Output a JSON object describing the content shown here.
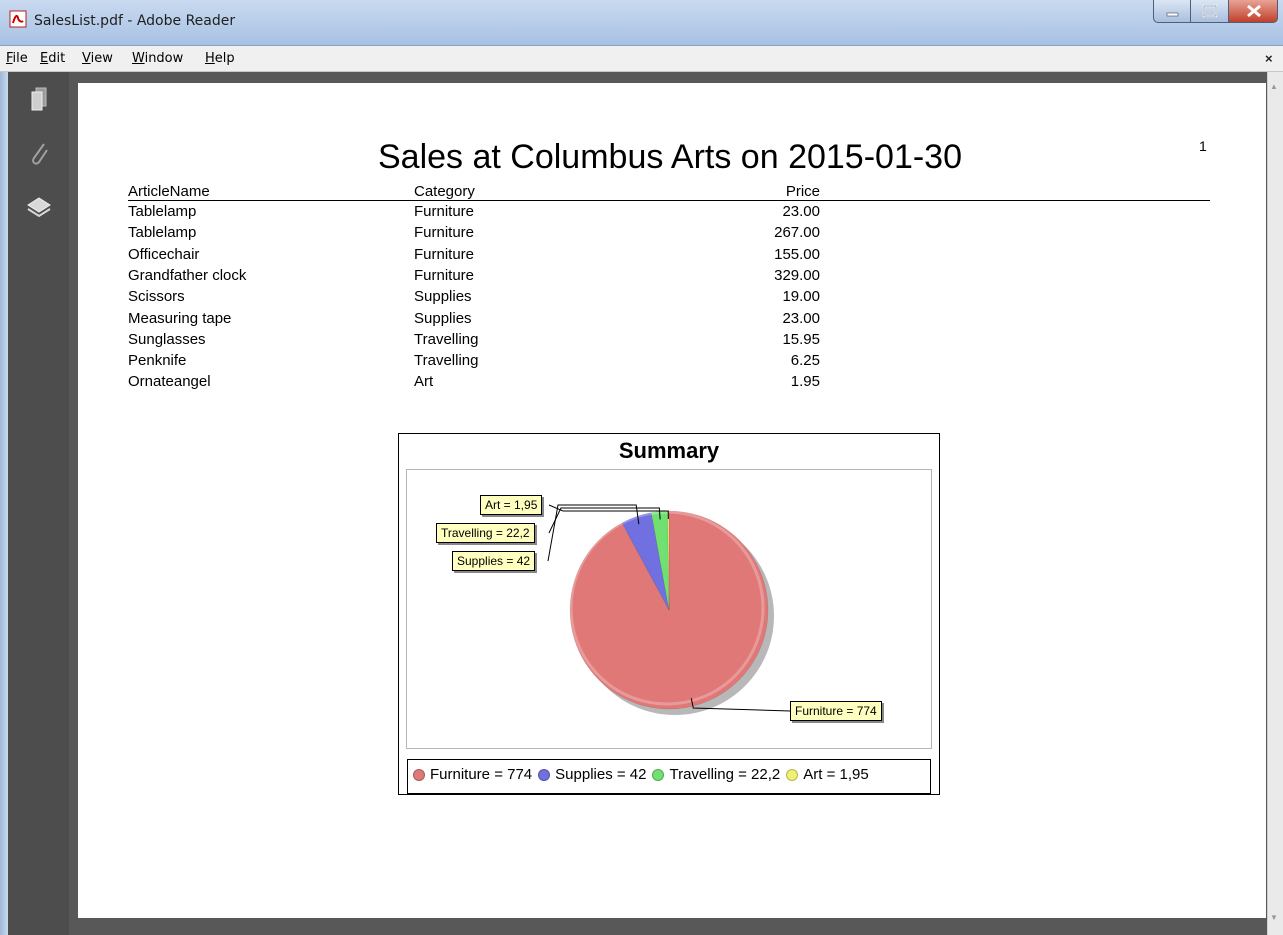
{
  "window": {
    "title": "SalesList.pdf - Adobe Reader"
  },
  "menu": {
    "items": [
      {
        "label": "File",
        "accel": "F",
        "rest": "ile"
      },
      {
        "label": "Edit",
        "accel": "E",
        "rest": "dit"
      },
      {
        "label": "View",
        "accel": "V",
        "rest": "iew"
      },
      {
        "label": "Window",
        "accel": "W",
        "rest": "indow"
      },
      {
        "label": "Help",
        "accel": "H",
        "rest": "elp"
      }
    ],
    "close_glyph": "×"
  },
  "sidebar": {
    "tools": [
      "pages-icon",
      "attachment-icon",
      "layers-icon"
    ]
  },
  "report": {
    "title": "Sales at Columbus Arts on 2015-01-30",
    "page_number": "1",
    "headers": {
      "article": "ArticleName",
      "category": "Category",
      "price": "Price"
    },
    "rows": [
      {
        "article": "Tablelamp",
        "category": "Furniture",
        "price": "23.00"
      },
      {
        "article": "Tablelamp",
        "category": "Furniture",
        "price": "267.00"
      },
      {
        "article": "Officechair",
        "category": "Furniture",
        "price": "155.00"
      },
      {
        "article": "Grandfather clock",
        "category": "Furniture",
        "price": "329.00"
      },
      {
        "article": "Scissors",
        "category": "Supplies",
        "price": "19.00"
      },
      {
        "article": "Measuring tape",
        "category": "Supplies",
        "price": "23.00"
      },
      {
        "article": "Sunglasses",
        "category": "Travelling",
        "price": "15.95"
      },
      {
        "article": "Penknife",
        "category": "Travelling",
        "price": "6.25"
      },
      {
        "article": "Ornateangel",
        "category": "Art",
        "price": "1.95"
      }
    ]
  },
  "chart_data": {
    "type": "pie",
    "title": "Summary",
    "categories": [
      "Furniture",
      "Supplies",
      "Travelling",
      "Art"
    ],
    "values": [
      774,
      42,
      22.2,
      1.95
    ],
    "labels": [
      "Furniture = 774",
      "Supplies = 42",
      "Travelling = 22,2",
      "Art = 1,95"
    ],
    "colors": [
      "#e07878",
      "#7070e0",
      "#70e070",
      "#f0f070"
    ],
    "legend_position": "bottom"
  }
}
